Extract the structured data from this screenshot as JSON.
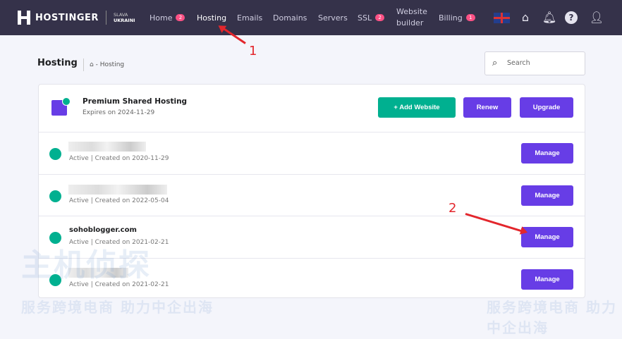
{
  "nav": {
    "brand": "HOSTINGER",
    "slava": "SLAVA",
    "ukraini": "UKRAINI",
    "items": [
      {
        "label": "Home",
        "badge": "2"
      },
      {
        "label": "Hosting"
      },
      {
        "label": "Emails"
      },
      {
        "label": "Domains"
      },
      {
        "label": "Servers"
      },
      {
        "label": "SSL",
        "badge": "2"
      },
      {
        "label": "Website",
        "label2": "builder"
      },
      {
        "label": "Billing",
        "badge": "1"
      }
    ]
  },
  "page": {
    "title": "Hosting",
    "breadcrumb": "Hosting",
    "search_placeholder": "Search"
  },
  "plan": {
    "name": "Premium Shared Hosting",
    "expires": "Expires on 2024-11-29",
    "add_website": "+ Add Website",
    "renew": "Renew",
    "upgrade": "Upgrade"
  },
  "sites": [
    {
      "name": "",
      "status": "Active | Created on 2020-11-29",
      "action": "Manage"
    },
    {
      "name": "",
      "status": "Active | Created on 2022-05-04",
      "action": "Manage"
    },
    {
      "name": "sohoblogger.com",
      "status": "Active | Created on 2021-02-21",
      "action": "Manage"
    },
    {
      "name": "",
      "status": "Active | Created on 2021-02-21",
      "action": "Manage"
    }
  ],
  "annotations": {
    "one": "1",
    "two": "2"
  },
  "watermark": {
    "line1": "主机侦探",
    "line2": "服务跨境电商 助力中企出海"
  },
  "colors": {
    "nav": "#35324a",
    "primary": "#673de6",
    "green": "#00b090",
    "badge": "#fc5185"
  }
}
